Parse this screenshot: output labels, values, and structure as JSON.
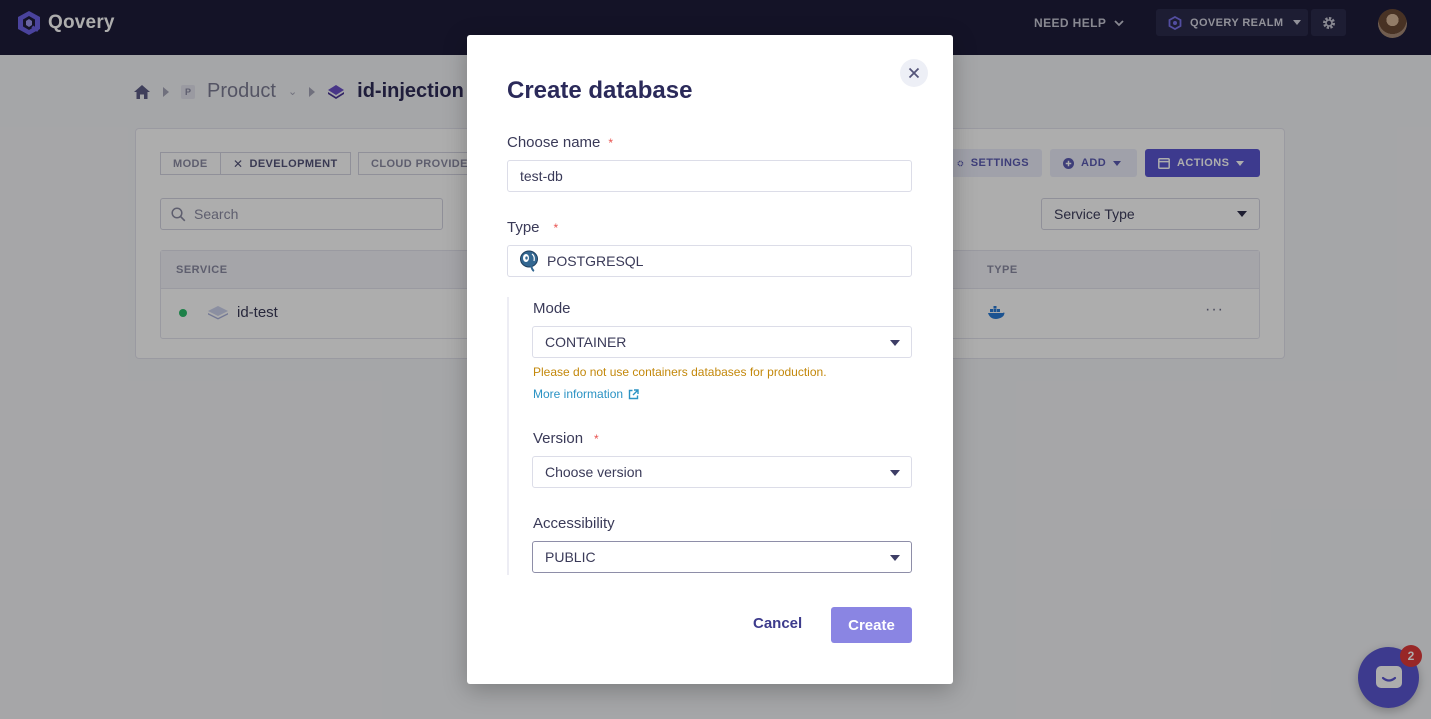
{
  "topbar": {
    "brand": "Qovery",
    "help_label": "NEED HELP",
    "org_label": "QOVERY REALM"
  },
  "breadcrumb": {
    "project_badge": "P",
    "project": "Product",
    "environment": "id-injection"
  },
  "toolbar": {
    "mode_label": "MODE",
    "mode_value": "DEVELOPMENT",
    "cloud_label": "CLOUD PROVIDER",
    "settings_label": "SETTINGS",
    "add_label": "ADD",
    "actions_label": "ACTIONS"
  },
  "search": {
    "placeholder": "Search"
  },
  "filter": {
    "service_type": "Service Type"
  },
  "table": {
    "headers": {
      "service": "SERVICE",
      "type": "TYPE"
    },
    "rows": [
      {
        "name": "id-test",
        "status": "running",
        "type_icon": "docker-icon"
      }
    ]
  },
  "modal": {
    "title": "Create database",
    "name_label": "Choose name",
    "name_value": "test-db",
    "type_label": "Type",
    "type_value": "POSTGRESQL",
    "type_icon": "postgresql-icon",
    "mode_label": "Mode",
    "mode_value": "CONTAINER",
    "mode_warning": "Please do not use containers databases for production.",
    "more_info": "More information",
    "version_label": "Version",
    "version_placeholder": "Choose version",
    "accessibility_label": "Accessibility",
    "accessibility_value": "PUBLIC",
    "required_mark": "*",
    "cancel_label": "Cancel",
    "create_label": "Create"
  },
  "chat": {
    "badge_count": "2"
  },
  "colors": {
    "topbar": "#1e1d3a",
    "accent": "#5b56d2",
    "create_button": "#8a85e3",
    "warning": "#c3880b",
    "link": "#2b93c4",
    "required": "#e8524f"
  }
}
